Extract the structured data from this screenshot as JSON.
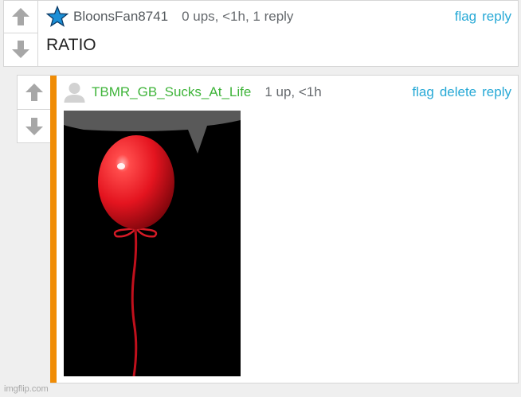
{
  "comment1": {
    "username": "BloonsFan8741",
    "meta": "0 ups, <1h, 1 reply",
    "text": "RATIO",
    "actions": {
      "flag": "flag",
      "reply": "reply"
    },
    "icon": "blue-star-icon"
  },
  "comment2": {
    "username": "TBMR_GB_Sucks_At_Life",
    "meta": "1 up, <1h",
    "actions": {
      "flag": "flag",
      "delete": "delete",
      "reply": "reply"
    },
    "icon": "avatar-placeholder-icon",
    "image": "red balloon on black background with speech bubble"
  },
  "colors": {
    "link": "#27a9d6",
    "username_green": "#3fb43a",
    "accent": "#f08c05",
    "star": "#1b8fd6"
  },
  "footer": {
    "watermark": "imgflip.com"
  }
}
